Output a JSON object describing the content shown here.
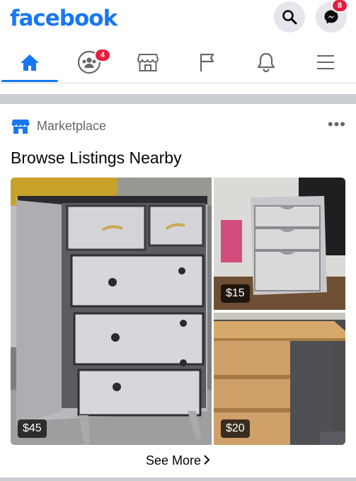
{
  "app": {
    "logo_text": "facebook",
    "brand_color": "#1877f2"
  },
  "header": {
    "search_icon": "search-icon",
    "messenger_icon": "messenger-icon",
    "messenger_badge": "8"
  },
  "nav": {
    "tabs": [
      {
        "icon": "home-icon",
        "active": true
      },
      {
        "icon": "groups-icon",
        "badge": "4"
      },
      {
        "icon": "marketplace-icon"
      },
      {
        "icon": "pages-flag-icon"
      },
      {
        "icon": "notifications-bell-icon"
      },
      {
        "icon": "menu-icon"
      }
    ],
    "groups_badge": "4"
  },
  "marketplace": {
    "section_label": "Marketplace",
    "title": "Browse Listings Nearby",
    "listings": [
      {
        "price": "$45",
        "item": "dresser"
      },
      {
        "price": "$15",
        "item": "filing-cabinet"
      },
      {
        "price": "$20",
        "item": "tv-stand"
      }
    ],
    "see_more_label": "See More"
  }
}
